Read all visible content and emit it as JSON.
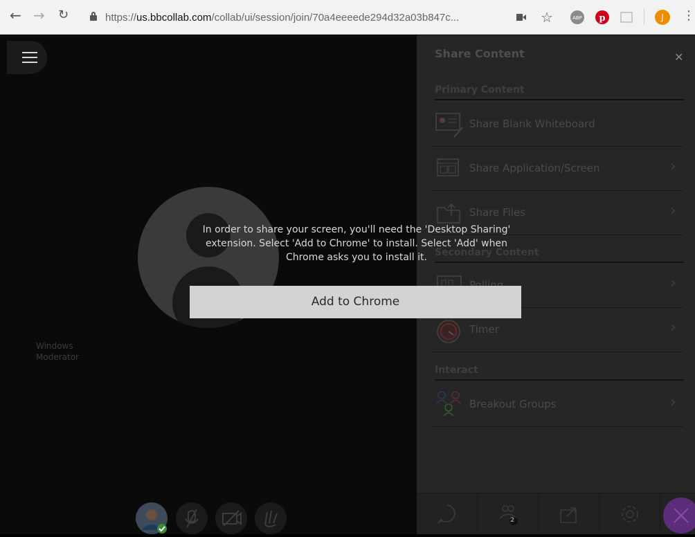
{
  "browser": {
    "url_scheme": "https://",
    "url_host": "us.bbcollab.com",
    "url_path": "/collab/ui/session/join/70a4eeeede294d32a03b847c...",
    "profile_initial": "J"
  },
  "stage": {
    "user_name": "Windows",
    "user_role": "Moderator"
  },
  "panel": {
    "title": "Share Content",
    "sections": [
      {
        "heading": "Primary Content",
        "items": [
          "Share Blank Whiteboard",
          "Share Application/Screen",
          "Share Files"
        ]
      },
      {
        "heading": "Secondary Content",
        "items": [
          "Polling",
          "Timer"
        ]
      },
      {
        "heading": "Interact",
        "items": [
          "Breakout Groups"
        ]
      }
    ],
    "footer": {
      "attendees_badge": "2"
    }
  },
  "dialog": {
    "message": "In order to share your screen, you'll need the 'Desktop Sharing' extension. Select 'Add to Chrome' to install. Select 'Add' when Chrome asks you to install it.",
    "button_label": "Add to Chrome"
  },
  "colors": {
    "accent": "#5c2d7a",
    "profile_badge": "#f08c00",
    "pinterest": "#d0021b"
  }
}
